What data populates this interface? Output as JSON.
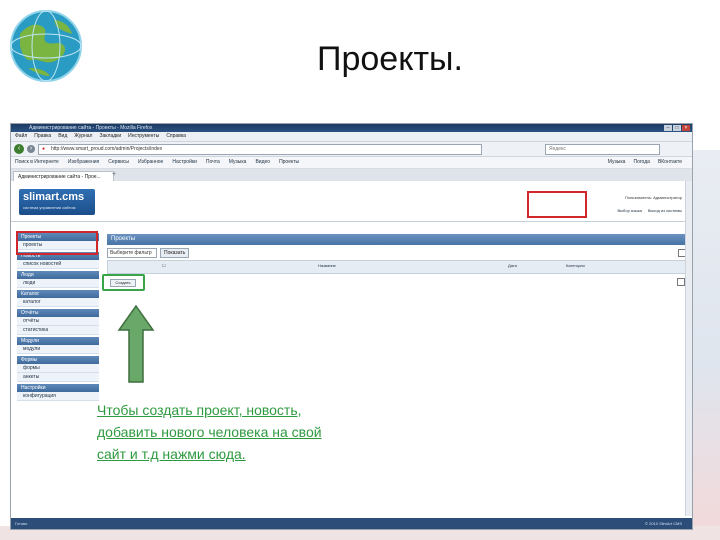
{
  "slide": {
    "title": "Проекты."
  },
  "browser": {
    "window_title": "Администрирование сайта - Проекты - Mozilla Firefox",
    "menu": [
      "Файл",
      "Правка",
      "Вид",
      "Журнал",
      "Закладки",
      "Инструменты",
      "Справка"
    ],
    "url": "http://www.smart_proud.com/admin/Projects/index",
    "search_placeholder": "Яндекс",
    "bookmarks": [
      "Поиск в Интернете",
      "Изображения",
      "Сервисы",
      "Избранное",
      "Настройки",
      "Почта",
      "Музыка",
      "Видео",
      "Проекты"
    ],
    "bookmarks_right": [
      "Музыка",
      "Погода",
      "ВКонтакте"
    ],
    "tab_title": "Администрирование сайта - Прое...",
    "new_tab": "+"
  },
  "cms": {
    "logo": "slimart.cms",
    "logo_tagline": "система управления сайтом",
    "user_info": "Пользователь: Администратор",
    "links": [
      "Выбор языка",
      "Выход из системы"
    ]
  },
  "sidebar": [
    {
      "title": "Проекты",
      "items": [
        "проекты"
      ]
    },
    {
      "title": "Новости",
      "items": [
        "список новостей"
      ]
    },
    {
      "title": "Люди",
      "items": [
        "люди"
      ]
    },
    {
      "title": "Каталог",
      "items": [
        "каталог"
      ]
    },
    {
      "title": "Отчёты",
      "items": [
        "отчёты",
        "статистика"
      ]
    },
    {
      "title": "Модули",
      "items": [
        "модули"
      ]
    },
    {
      "title": "Формы",
      "items": [
        "формы",
        "анкеты"
      ]
    },
    {
      "title": "Настройки",
      "items": [
        "конфигурация"
      ]
    }
  ],
  "content": {
    "title": "Проекты",
    "filter_select": "Выберите фильтр",
    "filter_button": "Показать",
    "columns": [
      "Название",
      "Дата",
      "Категория"
    ],
    "create_button": "Создать"
  },
  "hint": {
    "line1": "Чтобы создать проект, новость,",
    "line2": "добавить нового человека на свой",
    "line3": "сайт и т.д нажми сюда."
  },
  "status": {
    "left": "Готово",
    "right": "© 2010 SlimArt CMS"
  },
  "colors": {
    "highlight_red": "#d0282a",
    "highlight_green": "#3aa548",
    "hint_text": "#2e9a3f"
  }
}
